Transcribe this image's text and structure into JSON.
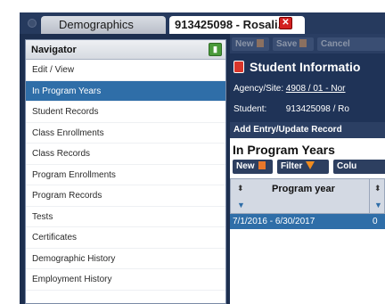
{
  "tabs": {
    "demographics_label": "Demographics",
    "student_label": "913425098 - Rosali...",
    "close_glyph": "✕"
  },
  "navigator": {
    "title": "Navigator",
    "pin_glyph": "▮",
    "items": [
      {
        "label": "Edit / View",
        "selected": false
      },
      {
        "label": "In Program Years",
        "selected": true
      },
      {
        "label": "Student Records",
        "selected": false
      },
      {
        "label": "Class Enrollments",
        "selected": false
      },
      {
        "label": "Class Records",
        "selected": false
      },
      {
        "label": "Program Enrollments",
        "selected": false
      },
      {
        "label": "Program Records",
        "selected": false
      },
      {
        "label": "Tests",
        "selected": false
      },
      {
        "label": "Certificates",
        "selected": false
      },
      {
        "label": "Demographic History",
        "selected": false
      },
      {
        "label": "Employment History",
        "selected": false
      }
    ]
  },
  "toolbar": {
    "new_label": "New",
    "save_label": "Save",
    "cancel_label": "Cancel"
  },
  "student_info": {
    "title": "Student Informatio",
    "agency_label": "Agency/Site:",
    "agency_value": "4908 / 01 - Nor",
    "student_label": "Student:",
    "student_value": "913425098 / Ro",
    "add_entry_label": "Add Entry/Update Record"
  },
  "section": {
    "title": "In Program Years",
    "new_label": "New",
    "filter_label": "Filter",
    "columns_label": "Colu"
  },
  "grid": {
    "sort_glyph": "⬍",
    "filter_glyph": "▼",
    "column_header": "Program year",
    "rows": [
      {
        "program_year": "7/1/2016 - 6/30/2017",
        "col2": "0"
      }
    ]
  },
  "colors": {
    "app_bg": "#1d2f4f",
    "selected_bg": "#2f6ea8",
    "close_red": "#d32020",
    "accent_orange": "#e8772a"
  }
}
